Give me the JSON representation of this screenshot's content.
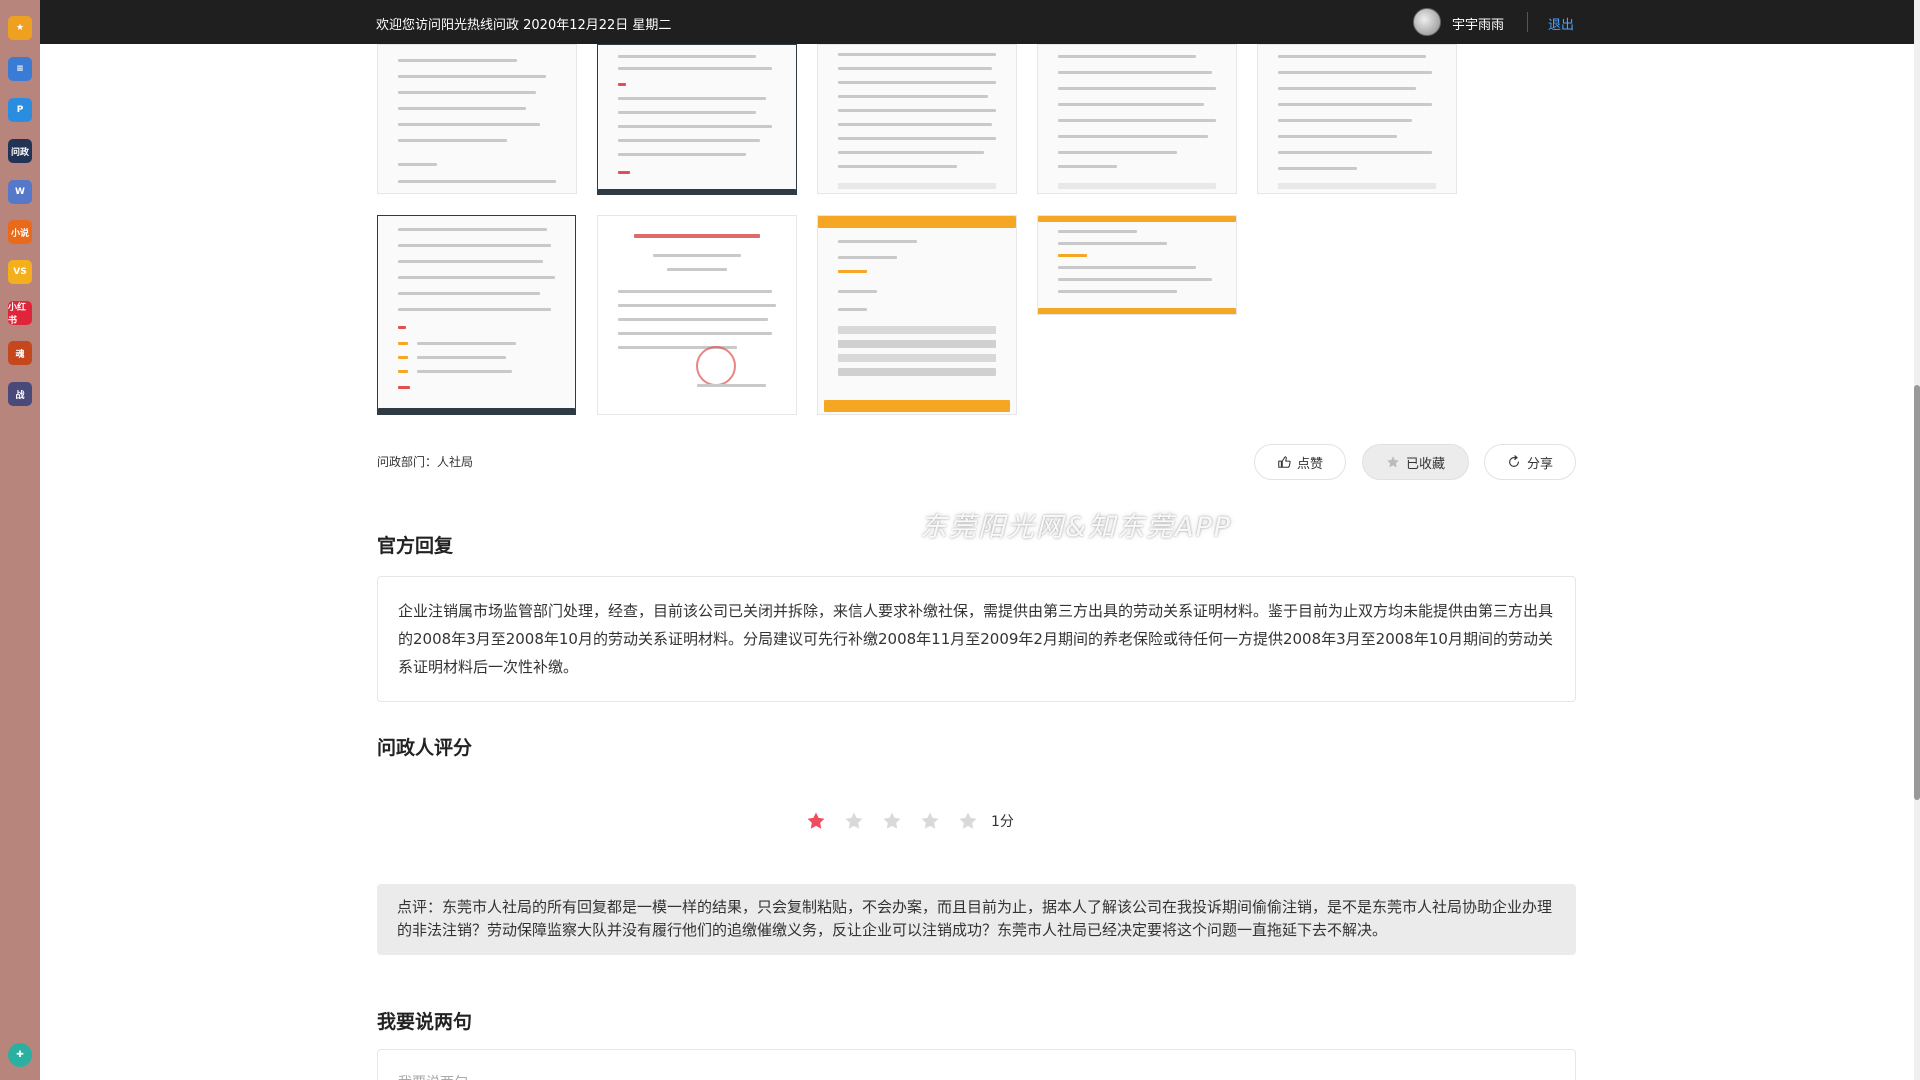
{
  "topbar": {
    "welcome": "欢迎您访问阳光热线问政  2020年12月22日  星期二",
    "username": "宇宇雨雨",
    "logout": "退出"
  },
  "dock": {
    "items": [
      {
        "name": "favorites-icon",
        "color": "#f0a020",
        "glyph": "★"
      },
      {
        "name": "docs-icon",
        "color": "#3a7bd5",
        "glyph": "≡"
      },
      {
        "name": "pinduoduo-icon",
        "color": "#2a8de0",
        "glyph": "P"
      },
      {
        "name": "wenzheng-app-icon",
        "color": "#223355",
        "glyph": "问政"
      },
      {
        "name": "word-doc-icon",
        "color": "#5578c8",
        "glyph": "W"
      },
      {
        "name": "novel-app-icon",
        "color": "#e86a1a",
        "glyph": "小说"
      },
      {
        "name": "game-app-icon",
        "color": "#f3b01c",
        "glyph": "VS"
      },
      {
        "name": "xiaohongshu-icon",
        "color": "#e0243a",
        "glyph": "小红书"
      },
      {
        "name": "game2-app-icon",
        "color": "#c4471d",
        "glyph": "魂"
      },
      {
        "name": "game3-app-icon",
        "color": "#4a4a7a",
        "glyph": "战"
      }
    ],
    "bottom_icon": {
      "name": "network-icon",
      "color": "#2ab0a0",
      "glyph": "✚"
    }
  },
  "meta": {
    "dept_label": "问政部门：人社局"
  },
  "actions": {
    "like": "点赞",
    "favorite": "已收藏",
    "share": "分享"
  },
  "watermark": "东莞阳光网&知东莞APP",
  "official_reply": {
    "title": "官方回复",
    "text": "企业注销属市场监管部门处理，经查，目前该公司已关闭并拆除，来信人要求补缴社保，需提供由第三方出具的劳动关系证明材料。鉴于目前为止双方均未能提供由第三方出具的2008年3月至2008年10月的劳动关系证明材料。分局建议可先行补缴2008年11月至2009年2月期间的养老保险或待任何一方提供2008年3月至2008年10月期间的劳动关系证明材料后一次性补缴。"
  },
  "rating": {
    "title": "问政人评分",
    "score_label": "1分",
    "stars": 1,
    "max_stars": 5,
    "active_color": "#ee4d5e",
    "inactive_color": "#d9d9d9"
  },
  "review": {
    "text": "点评：东莞市人社局的所有回复都是一模一样的结果，只会复制粘贴，不会办案，而且目前为止，据本人了解该公司在我投诉期间偷偷注销，是不是东莞市人社局协助企业办理的非法注销？劳动保障监察大队并没有履行他们的追缴催缴义务，反让企业可以注销成功？东莞市人社局已经决定要将这个问题一直拖延下去不解决。"
  },
  "say": {
    "title": "我要说两句",
    "placeholder": "我要说两句"
  }
}
